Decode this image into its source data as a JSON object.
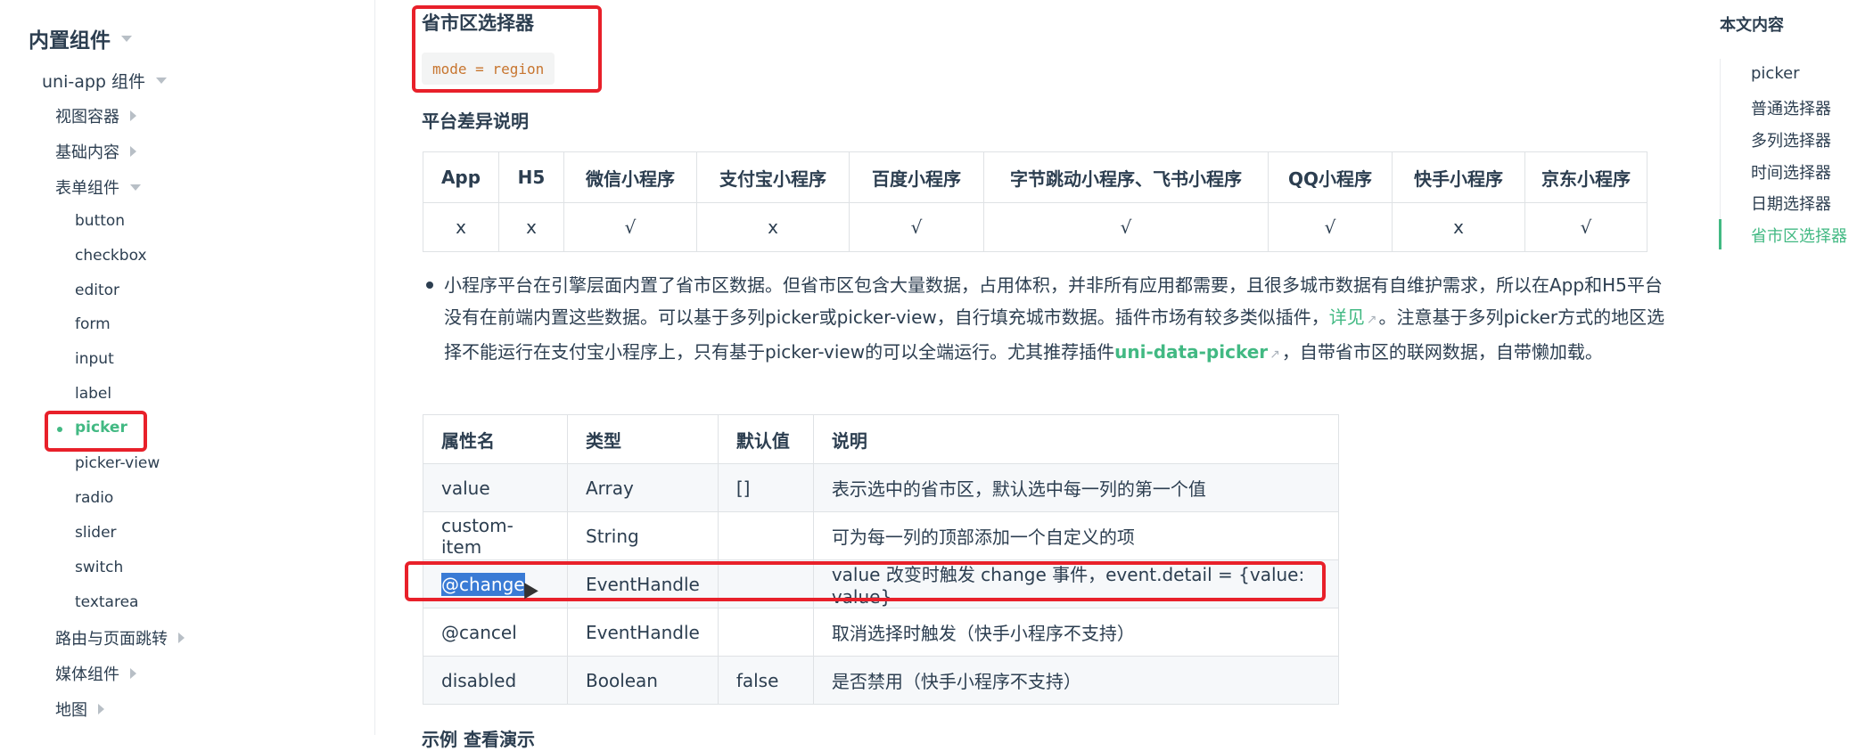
{
  "sidebar": {
    "title": "内置组件",
    "uni_app_group": "uni-app 组件",
    "groups": {
      "view_container": "视图容器",
      "basic_content": "基础内容",
      "form_components": "表单组件",
      "routing": "路由与页面跳转",
      "media": "媒体组件",
      "map": "地图"
    },
    "form_items": [
      "button",
      "checkbox",
      "editor",
      "form",
      "input",
      "label",
      "picker",
      "picker-view",
      "radio",
      "slider",
      "switch",
      "textarea"
    ],
    "active_item": "picker"
  },
  "main": {
    "section_title": "省市区选择器",
    "mode_code": "mode = region",
    "diff_title": "平台差异说明",
    "platform_table": {
      "headers": [
        "App",
        "H5",
        "微信小程序",
        "支付宝小程序",
        "百度小程序",
        "字节跳动小程序、飞书小程序",
        "QQ小程序",
        "快手小程序",
        "京东小程序"
      ],
      "values": [
        "x",
        "x",
        "√",
        "x",
        "√",
        "√",
        "√",
        "x",
        "√"
      ]
    },
    "note": {
      "part1": "小程序平台在引擎层面内置了省市区数据。但省市区包含大量数据，占用体积，并非所有应用都需要，且很多城市数据有自维护需求，所以在App和H5平台没有在前端内置这些数据。可以基于多列picker或picker-view，自行填充城市数据。插件市场有较多类似插件，",
      "link1": "详见",
      "part2": "。注意基于多列picker方式的地区选择不能运行在支付宝小程序上，只有基于picker-view的可以全端运行。尤其推荐插件",
      "link2": "uni-data-picker",
      "part3": "，自带省市区的联网数据，自带懒加载。"
    },
    "attr_table": {
      "headers": [
        "属性名",
        "类型",
        "默认值",
        "说明"
      ],
      "rows": [
        [
          "value",
          "Array",
          "[]",
          "表示选中的省市区，默认选中每一列的第一个值"
        ],
        [
          "custom-item",
          "String",
          "",
          "可为每一列的顶部添加一个自定义的项"
        ],
        [
          "@change",
          "EventHandle",
          "",
          "value 改变时触发 change 事件，event.detail = {value: value}"
        ],
        [
          "@cancel",
          "EventHandle",
          "",
          "取消选择时触发（快手小程序不支持）"
        ],
        [
          "disabled",
          "Boolean",
          "false",
          "是否禁用（快手小程序不支持）"
        ]
      ]
    },
    "example_title": "示例 查看演示"
  },
  "toc": {
    "title": "本文内容",
    "items": [
      "picker",
      "普通选择器",
      "多列选择器",
      "时间选择器",
      "日期选择器",
      "省市区选择器"
    ],
    "active": "省市区选择器"
  },
  "colors": {
    "accent": "#42b983",
    "highlight_box": "#e8202a",
    "text": "#2c3e50",
    "code": "#c7752f"
  }
}
